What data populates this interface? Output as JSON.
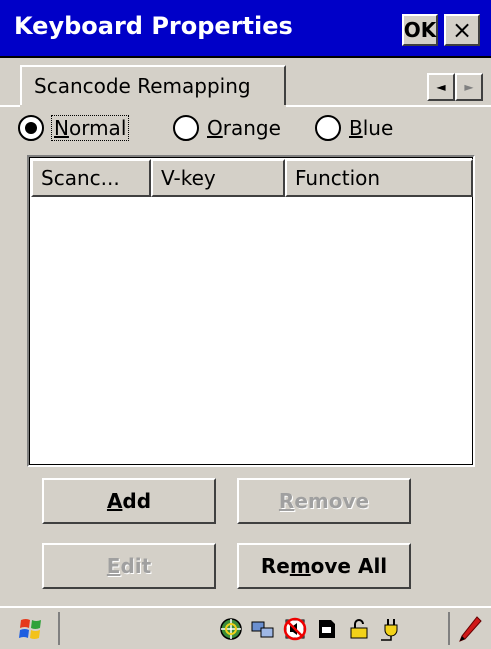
{
  "window": {
    "title": "Keyboard Properties",
    "ok_label": "OK",
    "close_label": "×"
  },
  "tabs": {
    "active_label": "Scancode Remapping",
    "prev_glyph": "◄",
    "next_glyph": "►"
  },
  "modes": {
    "selected": "Normal",
    "options": [
      {
        "prefix": "",
        "accel": "N",
        "rest": "ormal"
      },
      {
        "prefix": "",
        "accel": "O",
        "rest": "range"
      },
      {
        "prefix": "",
        "accel": "B",
        "rest": "lue"
      }
    ]
  },
  "list": {
    "columns": [
      "Scanc...",
      "V-key",
      "Function"
    ],
    "rows": []
  },
  "buttons": {
    "add": {
      "pre": "",
      "accel": "A",
      "post": "dd",
      "enabled": true
    },
    "remove": {
      "pre": "",
      "accel": "R",
      "post": "emove",
      "enabled": false
    },
    "edit": {
      "pre": "",
      "accel": "E",
      "post": "dit",
      "enabled": false
    },
    "remove_all": {
      "pre": "Re",
      "accel": "m",
      "post": "ove All",
      "enabled": true
    }
  },
  "taskbar": {
    "tray_icons": [
      "network-globe-icon",
      "network-connection-icon",
      "no-sound-icon",
      "storage-card-icon",
      "lock-icon",
      "power-plug-icon"
    ],
    "input_icon": "pen-icon"
  },
  "colors": {
    "titlebar": "#0000c8",
    "face": "#d4d0c8"
  }
}
